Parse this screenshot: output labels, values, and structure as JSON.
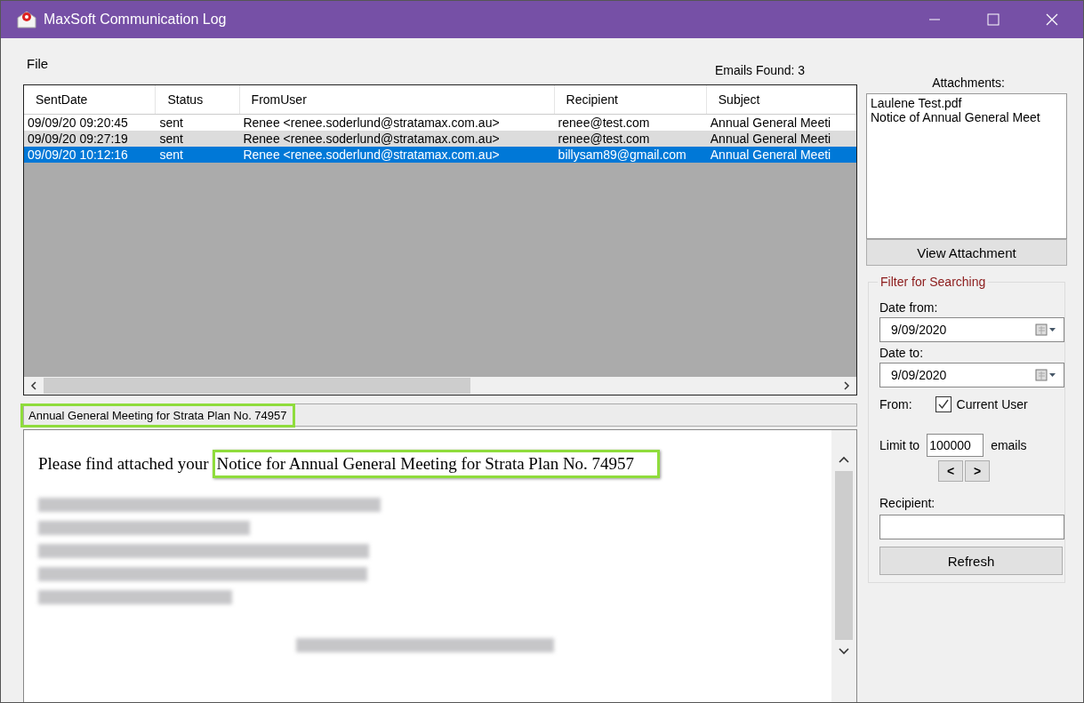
{
  "window": {
    "title": "MaxSoft Communication Log"
  },
  "menu": [
    "File"
  ],
  "emails_found": "Emails Found: 3",
  "table": {
    "columns": [
      "SentDate",
      "Status",
      "FromUser",
      "Recipient",
      "Subject"
    ],
    "rows": [
      {
        "cells": [
          "09/09/20 09:20:45",
          "sent",
          "Renee <renee.soderlund@stratamax.com.au>",
          "renee@test.com",
          "Annual General Meeti"
        ],
        "selected": false
      },
      {
        "cells": [
          "09/09/20 09:27:19",
          "sent",
          "Renee <renee.soderlund@stratamax.com.au>",
          "renee@test.com",
          "Annual General Meeti"
        ],
        "selected": false
      },
      {
        "cells": [
          "09/09/20 10:12:16",
          "sent",
          "Renee <renee.soderlund@stratamax.com.au>",
          "billysam89@gmail.com",
          "Annual General Meeti"
        ],
        "selected": true
      }
    ]
  },
  "subject": "Annual General Meeting for Strata Plan No. 74957",
  "body": {
    "intro": "Please find attached your",
    "highlighted": "Notice for Annual General Meeting for Strata Plan No. 74957"
  },
  "attachments": {
    "label": "Attachments:",
    "items": [
      "Laulene Test.pdf",
      "Notice of Annual General Meet"
    ],
    "button": "View Attachment"
  },
  "filter": {
    "title": "Filter for Searching",
    "date_from_label": "Date from:",
    "date_from": "9/09/2020",
    "date_to_label": "Date to:",
    "date_to": "9/09/2020",
    "from_label": "From:",
    "current_user": {
      "label": "Current User",
      "checked": true
    },
    "limit_label": "Limit to",
    "limit": "100000",
    "limit_unit": "emails",
    "prev": "<",
    "next": ">",
    "recipient_label": "Recipient:",
    "refresh": "Refresh"
  }
}
